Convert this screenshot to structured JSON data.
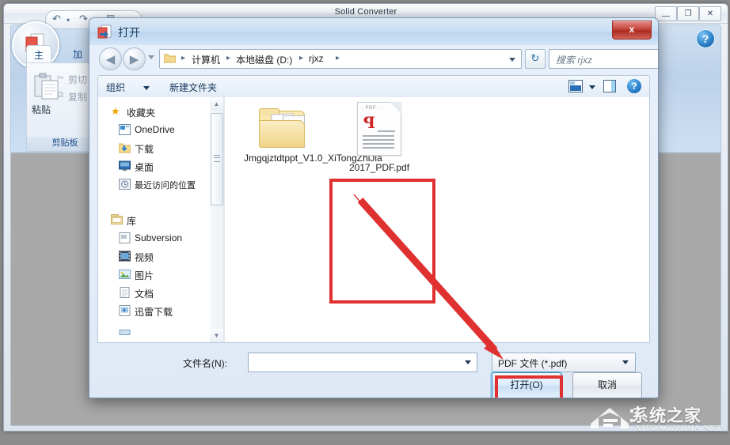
{
  "app": {
    "title": "Solid Converter",
    "window_controls": {
      "minimize": "—",
      "maximize": "❐",
      "close": "✕"
    },
    "ribbon": {
      "tabs": [
        {
          "label": "主页",
          "active": true
        },
        {
          "label": "加",
          "active": false
        }
      ],
      "clipboard": {
        "paste": "粘贴",
        "cut": "剪切",
        "copy": "复制",
        "group_label": "剪贴板"
      }
    },
    "help_icon": "?"
  },
  "dialog": {
    "title": "打开",
    "close_label": "x",
    "address": {
      "crumbs": [
        "计算机",
        "本地磁盘 (D:)",
        "rjxz"
      ],
      "separator": "▸",
      "refresh_icon": "↻"
    },
    "search": {
      "placeholder": "搜索 rjxz",
      "icon": "search-icon"
    },
    "commandbar": {
      "organize": "组织",
      "new_folder": "新建文件夹",
      "help": "?"
    },
    "nav_tree": [
      {
        "label": "收藏夹",
        "icon": "star-icon",
        "level": 0
      },
      {
        "label": "OneDrive",
        "icon": "onedrive-icon",
        "level": 1
      },
      {
        "label": "下载",
        "icon": "download-icon",
        "level": 1
      },
      {
        "label": "桌面",
        "icon": "desktop-icon",
        "level": 1
      },
      {
        "label": "最近访问的位置",
        "icon": "recent-icon",
        "level": 1
      },
      {
        "label": "库",
        "icon": "library-icon",
        "level": 0
      },
      {
        "label": "Subversion",
        "icon": "folder-doc-icon",
        "level": 1
      },
      {
        "label": "视频",
        "icon": "video-icon",
        "level": 1
      },
      {
        "label": "图片",
        "icon": "picture-icon",
        "level": 1
      },
      {
        "label": "文档",
        "icon": "document-icon",
        "level": 1
      },
      {
        "label": "迅雷下载",
        "icon": "thunder-icon",
        "level": 1
      }
    ],
    "files": [
      {
        "name": "Jmgqjztdtppt_V1.0_XiTongZhiJia",
        "type": "folder",
        "selected": false
      },
      {
        "name": "2017_PDF.pdf",
        "type": "pdf",
        "selected": true
      }
    ],
    "filename_label": "文件名(N):",
    "filename_value": "",
    "filetype_value": "PDF 文件 (*.pdf)",
    "open_button": "打开(O)",
    "cancel_button": "取消"
  },
  "annotations": {
    "highlight_color": "#e03131",
    "arrow_from": "selected pdf file",
    "arrow_to": "open button"
  },
  "watermark": {
    "title": "系统之家",
    "subtitle": "XITONGZHIJIA.NET"
  }
}
